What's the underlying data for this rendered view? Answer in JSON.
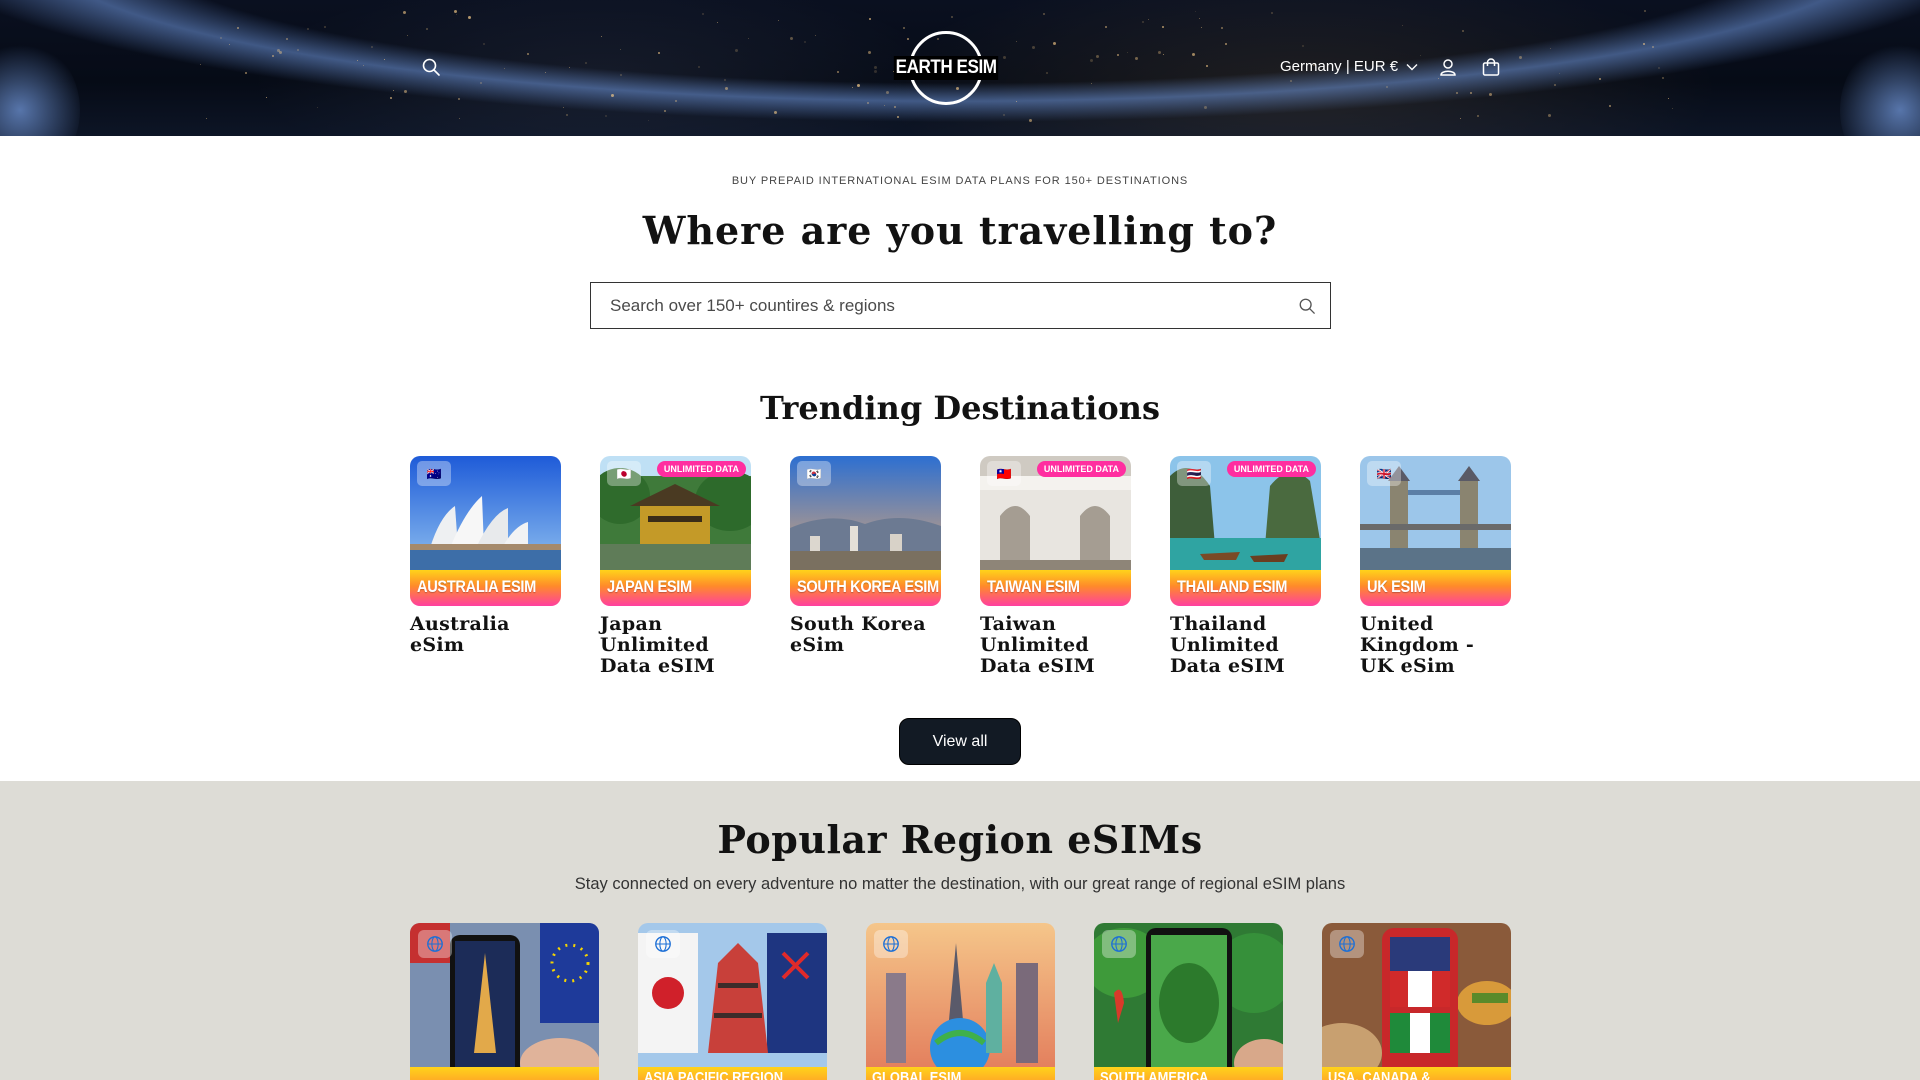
{
  "header": {
    "logo_text": "EARTH ESIM",
    "locale_label": "Germany | EUR €"
  },
  "hero": {
    "eyebrow": "BUY PREPAID INTERNATIONAL ESIM DATA PLANS FOR 150+ DESTINATIONS",
    "title": "Where are you travelling to?",
    "search_placeholder": "Search over 150+ countires & regions"
  },
  "trending": {
    "title": "Trending Destinations",
    "view_all_label": "View all",
    "products": [
      {
        "band": "AUSTRALIA ESIM",
        "title": "Australia eSim",
        "badge": "",
        "flag": "🇦🇺"
      },
      {
        "band": "JAPAN ESIM",
        "title": "Japan Unlimited Data eSIM",
        "badge": "UNLIMITED DATA",
        "flag": "🇯🇵"
      },
      {
        "band": "SOUTH KOREA ESIM",
        "title": "South Korea eSim",
        "badge": "",
        "flag": "🇰🇷"
      },
      {
        "band": "TAIWAN ESIM",
        "title": "Taiwan Unlimited Data eSIM",
        "badge": "UNLIMITED DATA",
        "flag": "🇹🇼"
      },
      {
        "band": "THAILAND ESIM",
        "title": "Thailand Unlimited Data eSIM",
        "badge": "UNLIMITED DATA",
        "flag": "🇹🇭"
      },
      {
        "band": "UK ESIM",
        "title": "United Kingdom - UK eSim",
        "badge": "",
        "flag": "🇬🇧"
      }
    ]
  },
  "regions": {
    "title": "Popular Region eSIMs",
    "subtitle": "Stay connected on every adventure no matter the destination, with our great range of regional eSIM plans",
    "cards": [
      {
        "band": ""
      },
      {
        "band": "ASIA PACIFIC REGION"
      },
      {
        "band": "GLOBAL ESIM"
      },
      {
        "band": "SOUTH AMERICA"
      },
      {
        "band": "USA, CANADA &"
      }
    ]
  },
  "colors": {
    "header_bg": "#070c18",
    "band_gradient_top": "#ffd31a",
    "band_gradient_bottom": "#ff3fa0",
    "badge_pink": "#ff2ea0",
    "button_dark": "#121a24",
    "region_bg": "#dddcd6"
  },
  "icons": {
    "header_search": "search-icon",
    "account": "user-icon",
    "cart": "bag-icon",
    "locale_chevron": "chevron-down-icon",
    "region_badge": "globe-icon"
  }
}
